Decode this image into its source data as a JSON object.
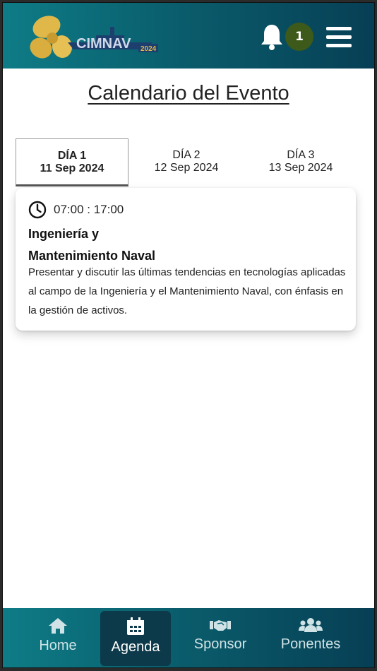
{
  "header": {
    "logo_text": "CIMNAV",
    "logo_year": "2024",
    "notification_count": "1"
  },
  "page": {
    "title": "Calendario del Evento"
  },
  "tabs": [
    {
      "day": "DÍA 1",
      "date": "11 Sep 2024",
      "active": true
    },
    {
      "day": "DÍA 2",
      "date": "12 Sep 2024",
      "active": false
    },
    {
      "day": "DÍA 3",
      "date": "13 Sep 2024",
      "active": false
    }
  ],
  "event": {
    "time": "07:00 : 17:00",
    "title_line1": "Ingeniería y",
    "title_line2": "Mantenimiento Naval",
    "description": "Presentar y discutir las últimas tendencias en tecnologías aplicadas al campo de la Ingeniería y el Mantenimiento Naval, con énfasis en la gestión de activos."
  },
  "bottom_nav": [
    {
      "label": "Home",
      "icon": "home-icon"
    },
    {
      "label": "Agenda",
      "icon": "calendar-icon",
      "active": true
    },
    {
      "label": "Sponsor",
      "icon": "handshake-icon"
    },
    {
      "label": "Ponentes",
      "icon": "users-icon"
    }
  ],
  "colors": {
    "header_start": "#0e7c86",
    "header_end": "#073f55",
    "badge": "#3d5a1a",
    "active_nav": "#0d3a4a"
  }
}
